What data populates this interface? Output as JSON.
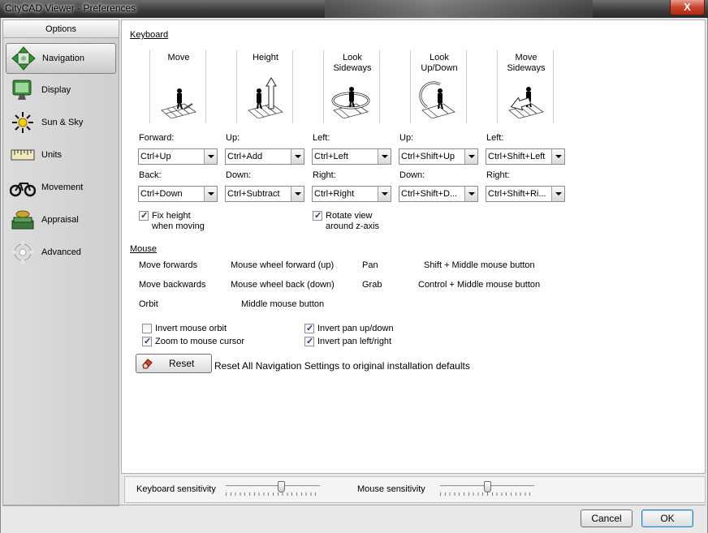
{
  "window": {
    "title": "CityCAD Viewer - Preferences",
    "close_glyph": "X"
  },
  "sidebar": {
    "header": "Options",
    "items": [
      {
        "label": "Navigation",
        "icon": "navigation-arrows-icon",
        "selected": true
      },
      {
        "label": "Display",
        "icon": "monitor-icon"
      },
      {
        "label": "Sun & Sky",
        "icon": "sun-icon"
      },
      {
        "label": "Units",
        "icon": "ruler-icon"
      },
      {
        "label": "Movement",
        "icon": "bicycle-icon"
      },
      {
        "label": "Appraisal",
        "icon": "money-icon"
      },
      {
        "label": "Advanced",
        "icon": "gear-icon"
      }
    ]
  },
  "keyboard": {
    "section_label": "Keyboard",
    "columns": [
      {
        "title": "Move",
        "label1": "Forward:",
        "value1": "Ctrl+Up",
        "label2": "Back:",
        "value2": "Ctrl+Down"
      },
      {
        "title": "Height",
        "label1": "Up:",
        "value1": "Ctrl+Add",
        "label2": "Down:",
        "value2": "Ctrl+Subtract"
      },
      {
        "title": "Look\nSideways",
        "label1": "Left:",
        "value1": "Ctrl+Left",
        "label2": "Right:",
        "value2": "Ctrl+Right"
      },
      {
        "title": "Look\nUp/Down",
        "label1": "Up:",
        "value1": "Ctrl+Shift+Up",
        "label2": "Down:",
        "value2": "Ctrl+Shift+D..."
      },
      {
        "title": "Move\nSideways",
        "label1": "Left:",
        "value1": "Ctrl+Shift+Left",
        "label2": "Right:",
        "value2": "Ctrl+Shift+Ri..."
      }
    ],
    "fix_height": {
      "line1": "Fix height",
      "line2": "when moving",
      "checked": true
    },
    "rotate_view": {
      "line1": "Rotate view",
      "line2": "around z-axis",
      "checked": true
    }
  },
  "mouse": {
    "section_label": "Mouse",
    "rows": [
      {
        "action": "Move forwards",
        "binding": "Mouse wheel forward (up)",
        "action2": "Pan",
        "binding2": "Shift + Middle mouse button"
      },
      {
        "action": "Move backwards",
        "binding": "Mouse wheel back (down)",
        "action2": "Grab",
        "binding2": "Control + Middle mouse button"
      },
      {
        "action": "Orbit",
        "binding": "Middle mouse button"
      }
    ],
    "options": [
      {
        "label": "Invert mouse orbit",
        "checked": false
      },
      {
        "label": "Zoom to mouse cursor",
        "checked": true
      },
      {
        "label": "Invert pan up/down",
        "checked": true
      },
      {
        "label": "Invert pan left/right",
        "checked": true
      }
    ]
  },
  "reset": {
    "button_label": "Reset",
    "description": "Reset All Navigation Settings to original installation defaults"
  },
  "sensitivity": {
    "keyboard_label": "Keyboard sensitivity",
    "keyboard_level": 0.6,
    "mouse_label": "Mouse sensitivity",
    "mouse_level": 0.5
  },
  "footer": {
    "cancel_label": "Cancel",
    "ok_label": "OK"
  }
}
